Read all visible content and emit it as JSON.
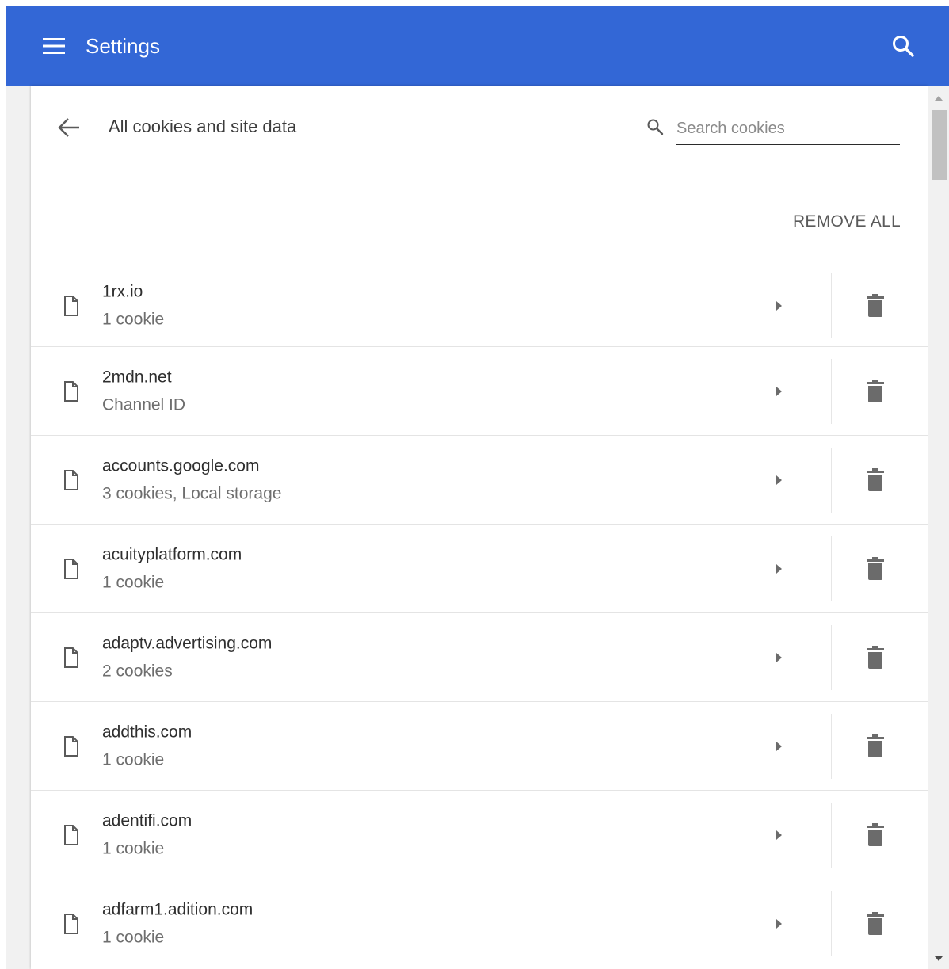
{
  "app": {
    "title": "Settings"
  },
  "toolbar": {
    "menu_icon": "hamburger-menu-icon",
    "search_icon": "search-icon"
  },
  "page": {
    "title": "All cookies and site data",
    "back_icon": "back-arrow-icon"
  },
  "search": {
    "placeholder": "Search cookies",
    "value": ""
  },
  "actions": {
    "remove_all_label": "REMOVE ALL"
  },
  "sites": [
    {
      "site": "1rx.io",
      "detail": "1 cookie"
    },
    {
      "site": "2mdn.net",
      "detail": "Channel ID"
    },
    {
      "site": "accounts.google.com",
      "detail": "3 cookies, Local storage"
    },
    {
      "site": "acuityplatform.com",
      "detail": "1 cookie"
    },
    {
      "site": "adaptv.advertising.com",
      "detail": "2 cookies"
    },
    {
      "site": "addthis.com",
      "detail": "1 cookie"
    },
    {
      "site": "adentifi.com",
      "detail": "1 cookie"
    },
    {
      "site": "adfarm1.adition.com",
      "detail": "1 cookie"
    }
  ],
  "colors": {
    "toolbar": "#3367d6",
    "icon_gray": "#6b6b6b"
  }
}
